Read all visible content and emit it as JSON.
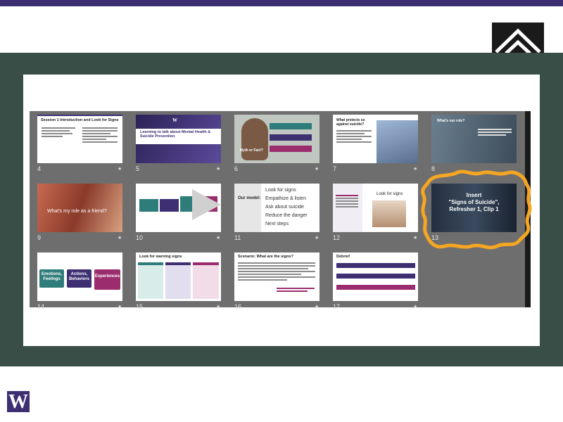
{
  "slides": [
    {
      "number": "4",
      "title": "Session 1 Introduction and Look for Signs"
    },
    {
      "number": "5",
      "title": "Learning to talk about Mental Health & Suicide Prevention"
    },
    {
      "number": "6",
      "title": "Myth or Fact?"
    },
    {
      "number": "7",
      "title": "What protects us against suicide?"
    },
    {
      "number": "8",
      "title": "What's our role?"
    },
    {
      "number": "9",
      "title": "What's my role as a friend?"
    },
    {
      "number": "10",
      "title": ""
    },
    {
      "number": "11",
      "title": "Our model:",
      "items": [
        "Look for signs",
        "Empathize & listen",
        "Ask about suicide",
        "Reduce the danger",
        "Next steps"
      ]
    },
    {
      "number": "12",
      "title": "Look for signs"
    },
    {
      "number": "13",
      "title": "Insert \"Signs of Suicide\", Refresher 1, Clip 1",
      "lines": [
        "Insert",
        "\"Signs of Suicide\",",
        "Refresher 1, Clip 1"
      ]
    },
    {
      "number": "14",
      "boxes": [
        "Emotions, Feelings",
        "Actions, Behaviors",
        "Experiences"
      ]
    },
    {
      "number": "15",
      "title": "Look for warning signs"
    },
    {
      "number": "16",
      "title": "Scenario: What are the signs?"
    },
    {
      "number": "17",
      "title": "Debrief"
    }
  ],
  "colors": {
    "brand_purple": "#3d2f72",
    "band_green": "#3a4e48",
    "sorter_gray": "#6e6e6e",
    "highlight_orange": "#f5a623",
    "teal": "#2e7d7a",
    "magenta": "#9b2d6e"
  },
  "icons": {
    "corner_logo": "chevron-mountain-logo",
    "brand_logo": "w-logo",
    "slide_star": "star-icon"
  },
  "brand_letter": "W"
}
